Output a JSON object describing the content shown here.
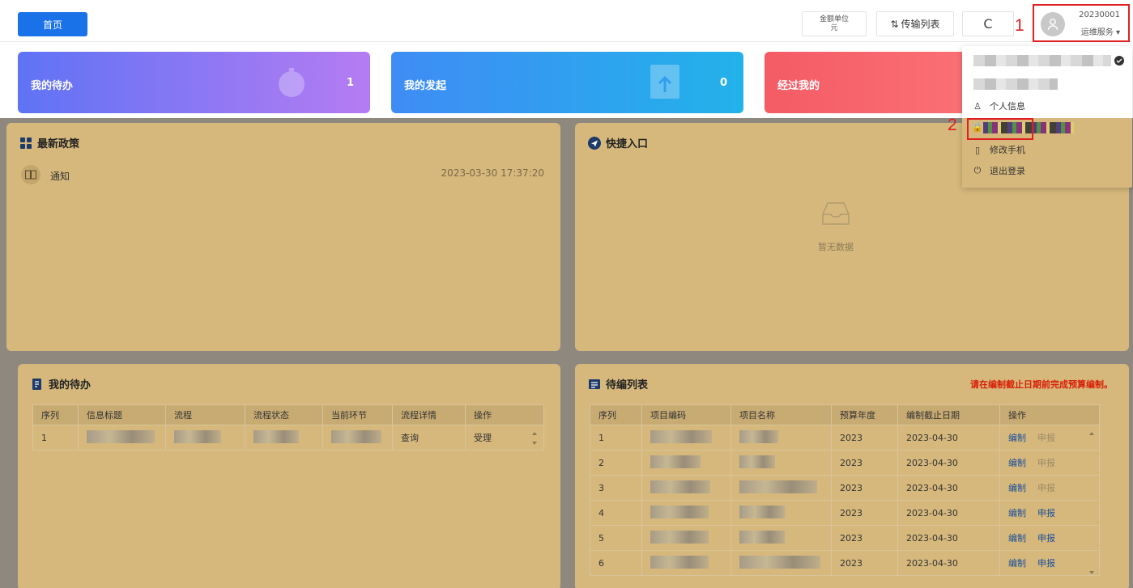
{
  "header": {
    "home_label": "首页",
    "unit_line1": "金额单位",
    "unit_line2": "元",
    "transfer_label": "传输列表",
    "refresh_symbol": "C",
    "user_id": "20230001",
    "user_role": "运维服务 ▾"
  },
  "annotations": {
    "first": "1",
    "second": "2"
  },
  "stat_cards": [
    {
      "title": "我的待办",
      "count": "1"
    },
    {
      "title": "我的发起",
      "count": "0"
    },
    {
      "title": "经过我的",
      "count": ""
    }
  ],
  "policy_panel": {
    "title": "最新政策",
    "items": [
      {
        "text": "通知",
        "date": "2023-03-30 17:37:20"
      }
    ]
  },
  "quick_panel": {
    "title": "快捷入口",
    "empty_text": "暂无数据"
  },
  "todo_panel": {
    "title": "我的待办",
    "columns": [
      "序列",
      "信息标题",
      "流程",
      "流程状态",
      "当前环节",
      "流程详情",
      "操作"
    ],
    "rows": [
      {
        "index": "1",
        "detail": "查询",
        "action": "受理"
      }
    ]
  },
  "budget_panel": {
    "title": "待编列表",
    "hint": "请在编制截止日期前完成预算编制。",
    "columns": [
      "序列",
      "项目编码",
      "项目名称",
      "预算年度",
      "编制截止日期",
      "操作"
    ],
    "rows": [
      {
        "index": "1",
        "year": "2023",
        "deadline": "2023-04-30",
        "edit": "编制",
        "report": "申报"
      },
      {
        "index": "2",
        "year": "2023",
        "deadline": "2023-04-30",
        "edit": "编制",
        "report": "申报"
      },
      {
        "index": "3",
        "year": "2023",
        "deadline": "2023-04-30",
        "edit": "编制",
        "report": "申报"
      },
      {
        "index": "4",
        "year": "2023",
        "deadline": "2023-04-30",
        "edit": "编制",
        "report": "申报"
      },
      {
        "index": "5",
        "year": "2023",
        "deadline": "2023-04-30",
        "edit": "编制",
        "report": "申报"
      },
      {
        "index": "6",
        "year": "2023",
        "deadline": "2023-04-30",
        "edit": "编制",
        "report": "申报"
      }
    ]
  },
  "user_menu": {
    "items": [
      {
        "label": "个人信息"
      },
      {
        "label": "修改手机"
      },
      {
        "label": "退出登录"
      }
    ]
  },
  "colors": {
    "accent": "#1a72e8",
    "annotation": "#e02020",
    "overlay_panel": "#d6b87c"
  }
}
